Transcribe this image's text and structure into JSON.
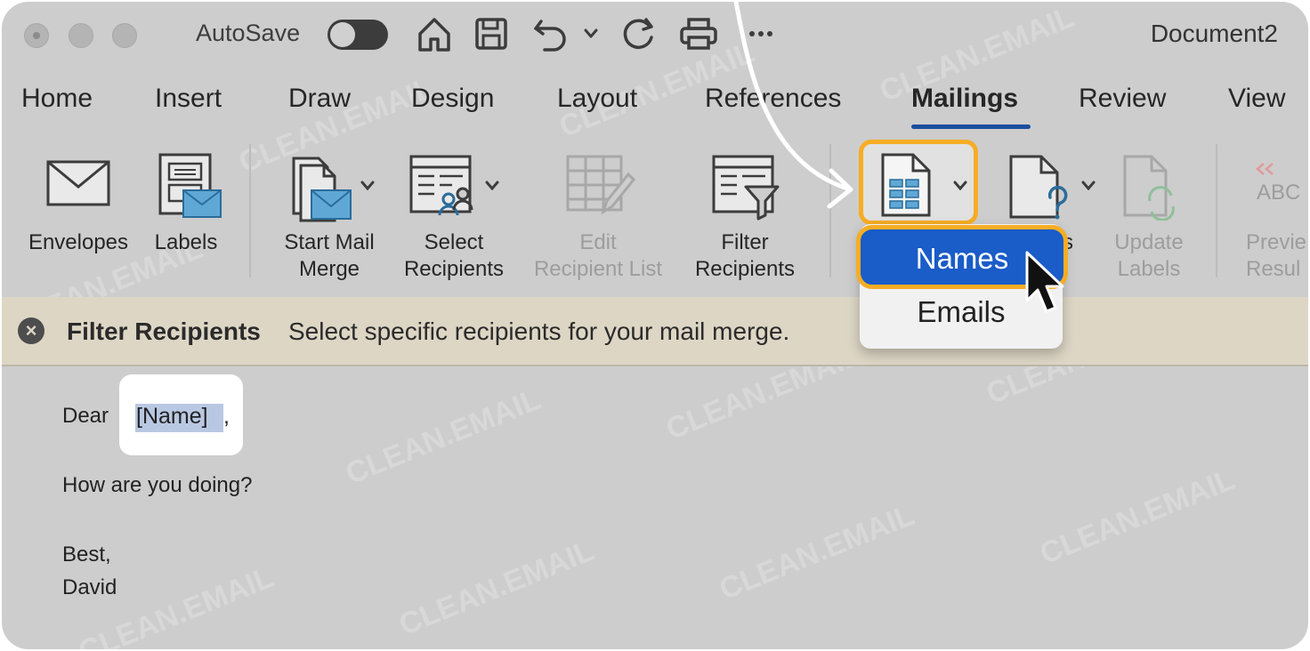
{
  "window": {
    "autosave_label": "AutoSave",
    "doc_title": "Document2"
  },
  "tabs": [
    "Home",
    "Insert",
    "Draw",
    "Design",
    "Layout",
    "References",
    "Mailings",
    "Review",
    "View"
  ],
  "active_tab": "Mailings",
  "ribbon": {
    "envelopes": "Envelopes",
    "labels": "Labels",
    "start_mail_merge": [
      "Start Mail",
      "Merge"
    ],
    "select_recipients": [
      "Select",
      "Recipients"
    ],
    "edit_recipient_list": [
      "Edit",
      "Recipient List"
    ],
    "filter_recipients": [
      "Filter",
      "Recipients"
    ],
    "partial_label": "s",
    "update_labels": [
      "Update",
      "Labels"
    ],
    "preview_results": [
      "Previe",
      "Resul"
    ],
    "abc_glyph": "ABC"
  },
  "dropdown": {
    "names": "Names",
    "emails": "Emails"
  },
  "infobar": {
    "title": "Filter Recipients",
    "message": "Select specific recipients for your mail merge."
  },
  "document": {
    "salutation": "Dear",
    "name_field": "[Name]",
    "comma": ",",
    "line2": "How are you doing?",
    "closing": "Best,",
    "signature": "David"
  },
  "watermark": "CLEAN.EMAIL",
  "colors": {
    "highlight": "#f6ad24",
    "selected": "#1a5cc8",
    "tab_underline": "#1c4f9e"
  }
}
